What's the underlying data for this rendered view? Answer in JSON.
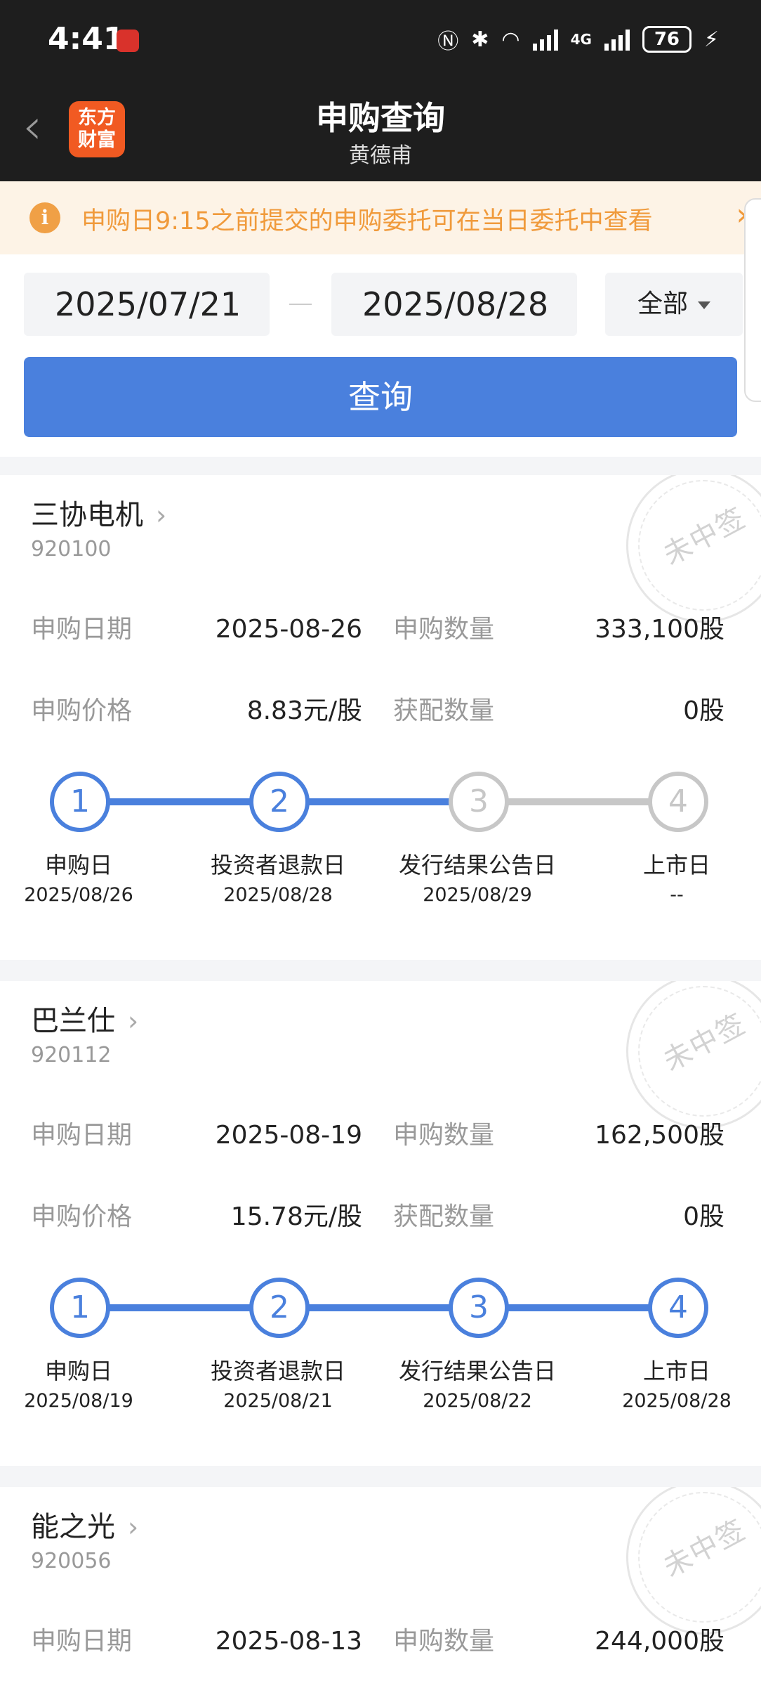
{
  "status_bar": {
    "time": "4:41",
    "network": "4G",
    "battery": "76"
  },
  "header": {
    "title": "申购查询",
    "subtitle": "黄德甫",
    "logo_line1": "东方",
    "logo_line2": "财富"
  },
  "notice": {
    "text": "申购日9:15之前提交的申购委托可在当日委托中查看"
  },
  "filter": {
    "start_date": "2025/07/21",
    "end_date": "2025/08/28",
    "type_selected": "全部",
    "query_button": "查询"
  },
  "labels": {
    "subscribe_date": "申购日期",
    "subscribe_qty": "申购数量",
    "subscribe_price": "申购价格",
    "allotted_qty": "获配数量",
    "stamp": "未中签"
  },
  "records": [
    {
      "name": "三协电机",
      "code": "920100",
      "subscribe_date": "2025-08-26",
      "subscribe_qty": "333,100股",
      "price": "8.83元/股",
      "allotted": "0股",
      "steps": [
        {
          "num": "1",
          "label": "申购日",
          "date": "2025/08/26",
          "active": true
        },
        {
          "num": "2",
          "label": "投资者退款日",
          "date": "2025/08/28",
          "active": true
        },
        {
          "num": "3",
          "label": "发行结果公告日",
          "date": "2025/08/29",
          "active": false
        },
        {
          "num": "4",
          "label": "上市日",
          "date": "--",
          "active": false
        }
      ]
    },
    {
      "name": "巴兰仕",
      "code": "920112",
      "subscribe_date": "2025-08-19",
      "subscribe_qty": "162,500股",
      "price": "15.78元/股",
      "allotted": "0股",
      "steps": [
        {
          "num": "1",
          "label": "申购日",
          "date": "2025/08/19",
          "active": true
        },
        {
          "num": "2",
          "label": "投资者退款日",
          "date": "2025/08/21",
          "active": true
        },
        {
          "num": "3",
          "label": "发行结果公告日",
          "date": "2025/08/22",
          "active": true
        },
        {
          "num": "4",
          "label": "上市日",
          "date": "2025/08/28",
          "active": true
        }
      ]
    },
    {
      "name": "能之光",
      "code": "920056",
      "subscribe_date": "2025-08-13",
      "subscribe_qty": "244,000股"
    }
  ]
}
